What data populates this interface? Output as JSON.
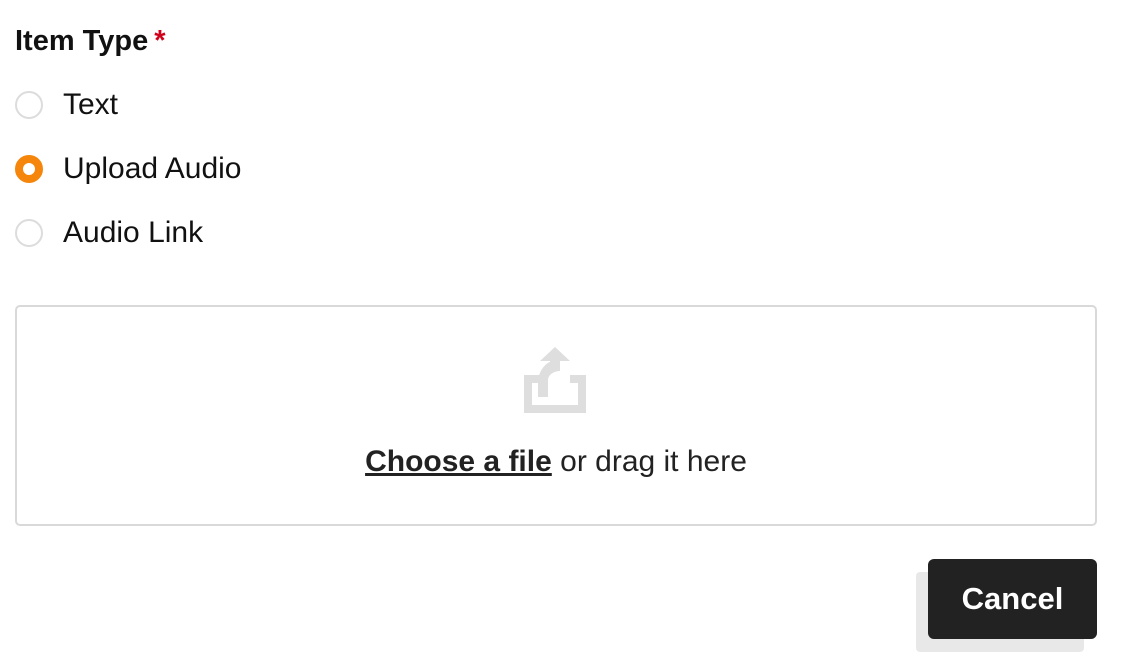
{
  "form": {
    "field_label": "Item Type",
    "required_mark": "*",
    "accent_color": "#f5860b",
    "required_color": "#d0021b"
  },
  "radio_options": [
    {
      "label": "Text",
      "selected": false
    },
    {
      "label": "Upload Audio",
      "selected": true
    },
    {
      "label": "Audio Link",
      "selected": false
    }
  ],
  "dropzone": {
    "icon": "upload-icon",
    "link_text": "Choose a file",
    "rest_text": " or drag it here"
  },
  "actions": {
    "cancel_label": "Cancel"
  }
}
